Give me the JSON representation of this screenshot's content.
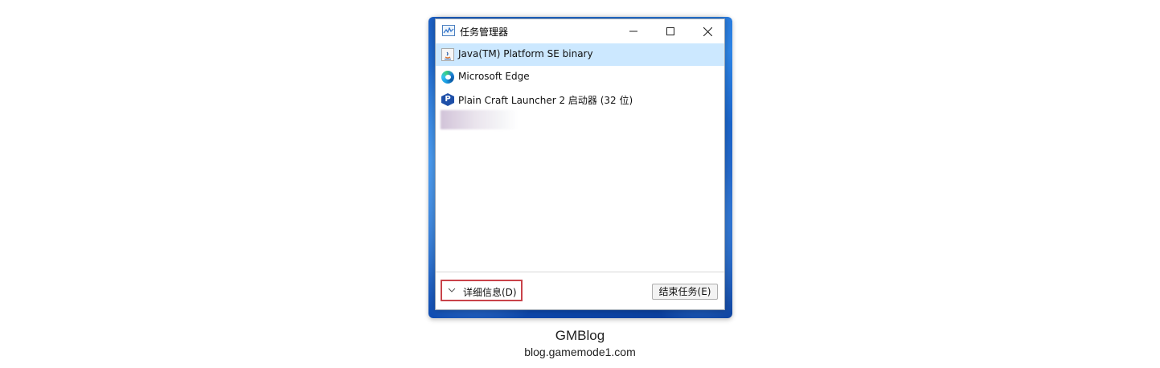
{
  "window": {
    "title": "任务管理器",
    "icon": "task-manager-icon",
    "controls": {
      "minimize": "minimize-icon",
      "maximize": "maximize-icon",
      "close": "close-icon"
    }
  },
  "apps": [
    {
      "label": "Java(TM) Platform SE binary",
      "icon": "java-icon",
      "selected": true
    },
    {
      "label": "Microsoft Edge",
      "icon": "edge-icon",
      "selected": false
    },
    {
      "label": "Plain Craft Launcher 2 启动器 (32 位)",
      "icon": "pcl-icon",
      "selected": false
    }
  ],
  "footer": {
    "details_label": "详细信息(D)",
    "end_task_label": "结束任务(E)"
  },
  "caption": {
    "title": "GMBlog",
    "url": "blog.gamemode1.com"
  },
  "colors": {
    "selection": "#cce8ff",
    "highlight_border": "#c9434a",
    "wallpaper": "#1c5fc4"
  }
}
